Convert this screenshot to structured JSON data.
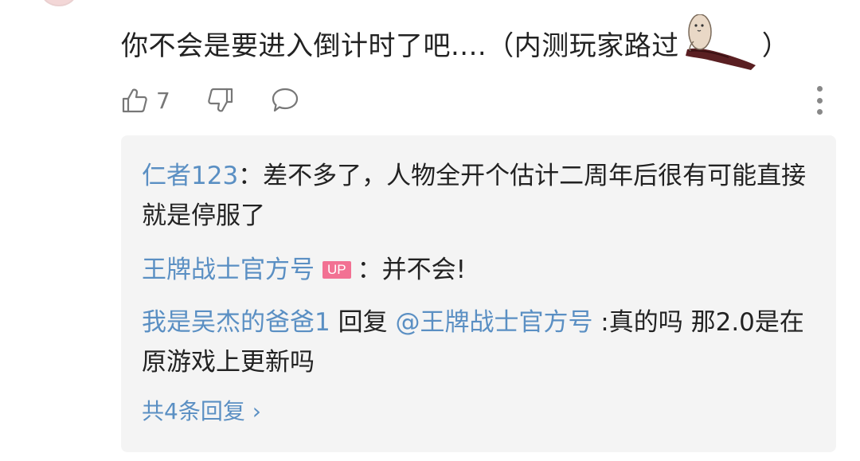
{
  "comment": {
    "text": "你不会是要进入倒计时了吧....（内测玩家路过",
    "close_paren": "）",
    "like_count": "7"
  },
  "replies": [
    {
      "user": "仁者123",
      "sep": "：",
      "text": "差不多了，人物全开个估计二周年后很有可能直接就是停服了"
    },
    {
      "user": "王牌战士官方号",
      "badge": "UP",
      "sep": "：",
      "text": "并不会!"
    },
    {
      "user": "我是吴杰的爸爸1",
      "reply_word": " 回复 ",
      "reply_target": "@王牌战士官方号",
      "text": " :真的吗 那2.0是在原游戏上更新吗"
    }
  ],
  "total_replies": "共4条回复 ›",
  "colors": {
    "username": "#5a8fc3",
    "badge": "#f27193",
    "reply_bg": "#f4f4f4"
  },
  "icons": [
    "thumbs-up-icon",
    "thumbs-down-icon",
    "comment-bubble-icon",
    "more-vertical-icon"
  ]
}
